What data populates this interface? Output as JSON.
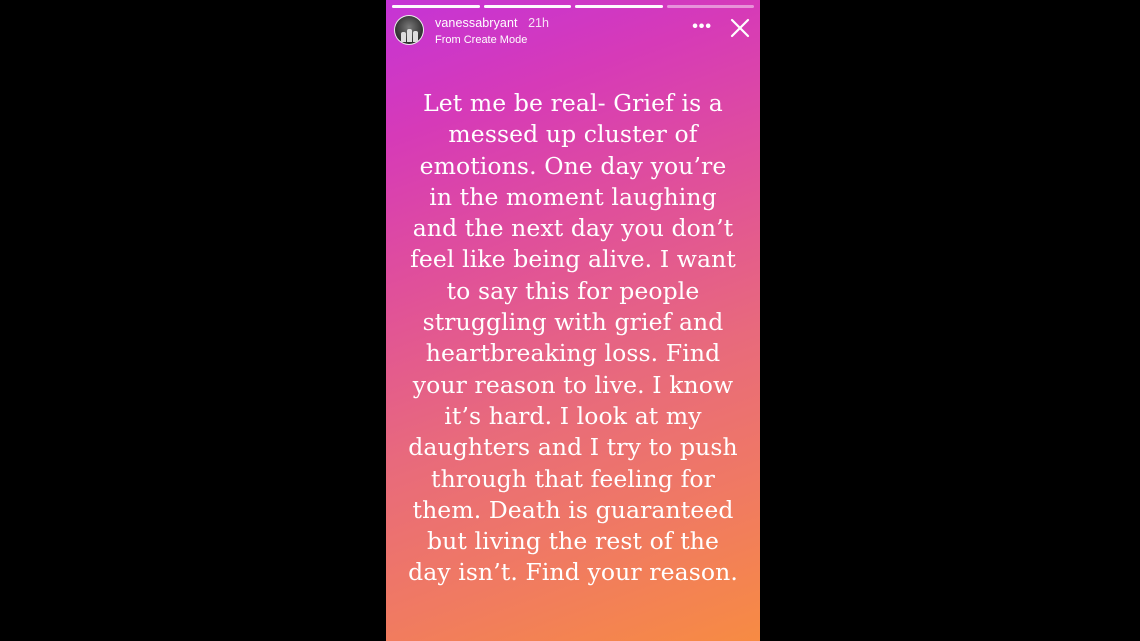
{
  "story": {
    "progress": [
      1,
      1,
      1,
      0.0
    ],
    "username": "vanessabryant",
    "time_ago": "21h",
    "subtitle": "From Create Mode",
    "more_label": "•••",
    "caption_lines": [
      "Let me be real- Grief is a",
      "messed up cluster of",
      "emotions. One day you’re",
      "in the moment laughing",
      "and the next day you don’t",
      "feel like being alive. I want",
      "to say this for people",
      "struggling with grief and",
      "heartbreaking loss. Find",
      "your reason to live. I know",
      "it’s hard. I look at my",
      "daughters and I try to push",
      "through that feeling for",
      "them. Death is guaranteed",
      "but living the rest of the",
      "day isn’t. Find your reason."
    ]
  },
  "colors": {
    "background": "#000000",
    "gradient_top": "#c534d6",
    "gradient_bottom": "#f78b43",
    "text": "#ffffff"
  },
  "icons": {
    "close": "close-icon",
    "more": "more-icon"
  }
}
